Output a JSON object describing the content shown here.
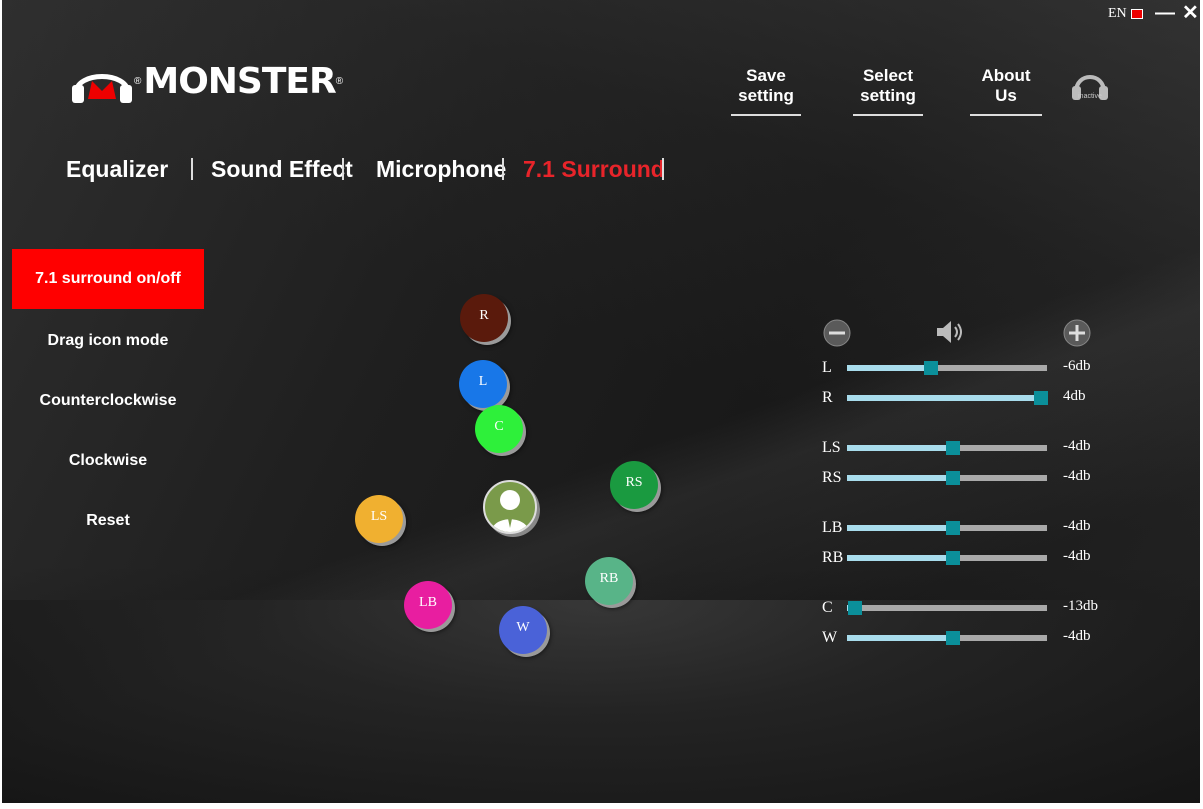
{
  "window": {
    "language": "EN",
    "minimize_icon": "minimize-icon",
    "close_icon": "close-icon"
  },
  "brand": {
    "name": "MONSTER",
    "registered_mark": "®"
  },
  "topnav": [
    {
      "label": "Save setting"
    },
    {
      "label": "Select setting"
    },
    {
      "label": "About Us"
    }
  ],
  "status": {
    "icon": "headset-icon",
    "label": "inactive"
  },
  "tabs": [
    {
      "label": "Equalizer",
      "active": false
    },
    {
      "label": "Sound Effect",
      "active": false
    },
    {
      "label": "Microphone",
      "active": false
    },
    {
      "label": "7.1 Surround",
      "active": true
    }
  ],
  "menu": [
    {
      "label": "7.1 surround on/off",
      "active": true
    },
    {
      "label": "Drag icon mode",
      "active": false
    },
    {
      "label": "Counterclockwise",
      "active": false
    },
    {
      "label": "Clockwise",
      "active": false
    },
    {
      "label": "Reset",
      "active": false
    }
  ],
  "speakers": [
    {
      "label": "R",
      "color": "#5a1a0c"
    },
    {
      "label": "L",
      "color": "#1877e8"
    },
    {
      "label": "C",
      "color": "#2ef03a"
    },
    {
      "label": "RS",
      "color": "#1a9a40"
    },
    {
      "label": "LS",
      "color": "#f0b030"
    },
    {
      "label": "RB",
      "color": "#58b488"
    },
    {
      "label": "LB",
      "color": "#e81ea0"
    },
    {
      "label": "W",
      "color": "#4a62d8"
    }
  ],
  "listener": {
    "icon": "listener-avatar-icon"
  },
  "mixer": {
    "decrease_icon": "minus-circle-icon",
    "volume_icon": "speaker-volume-icon",
    "increase_icon": "plus-circle-icon",
    "channels": [
      {
        "label": "L",
        "db": "-6db",
        "level": 0.42
      },
      {
        "label": "R",
        "db": "4db",
        "level": 0.97
      },
      {
        "label": "LS",
        "db": "-4db",
        "level": 0.53
      },
      {
        "label": "RS",
        "db": "-4db",
        "level": 0.53
      },
      {
        "label": "LB",
        "db": "-4db",
        "level": 0.53
      },
      {
        "label": "RB",
        "db": "-4db",
        "level": 0.53
      },
      {
        "label": "C",
        "db": "-13db",
        "level": 0.04
      },
      {
        "label": "W",
        "db": "-4db",
        "level": 0.53
      }
    ]
  },
  "colors": {
    "accent": "#ff0000",
    "active_tab": "#e8242a",
    "slider_thumb": "#0b8f9a",
    "slider_fill": "#a8dcec"
  }
}
